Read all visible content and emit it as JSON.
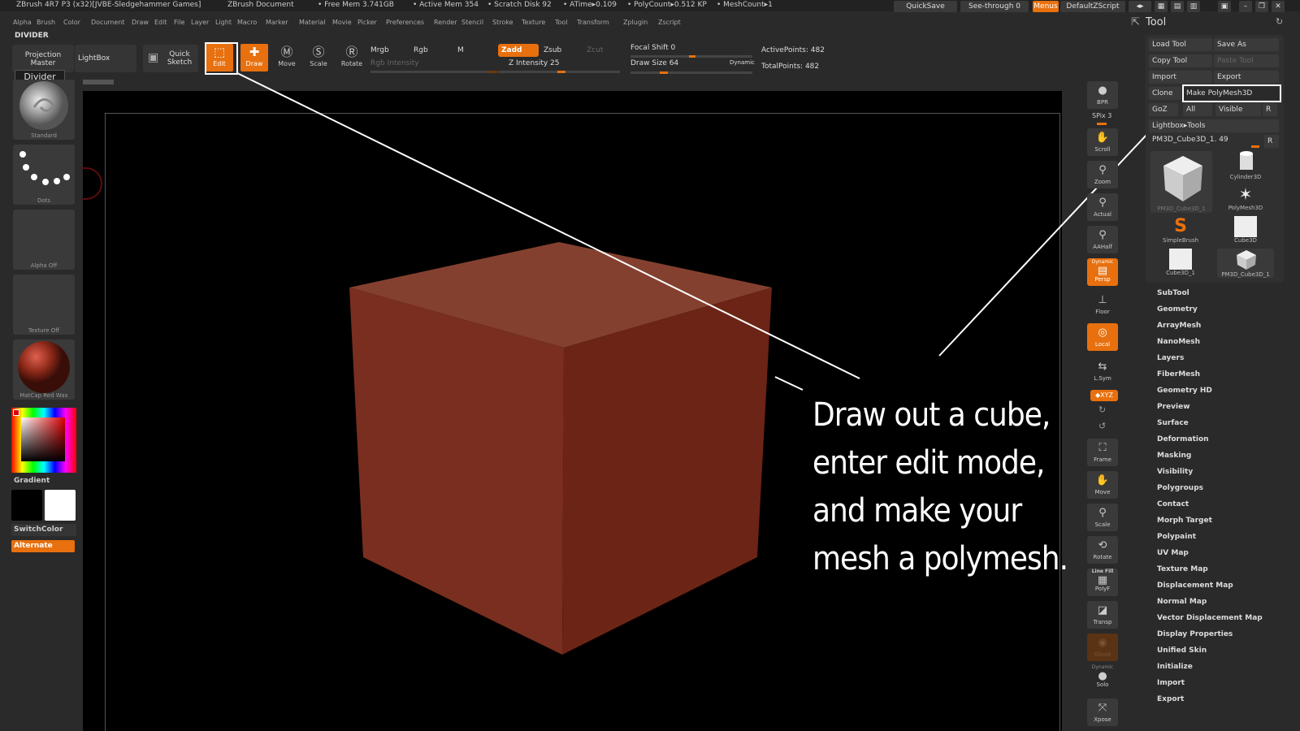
{
  "titlebar": {
    "app": "ZBrush 4R7 P3 (x32)[JVBE-Sledgehammer Games]",
    "doc": "ZBrush Document",
    "free_mem": "• Free Mem 3.741GB",
    "active_mem": "• Active Mem 354",
    "scratch": "• Scratch Disk 92",
    "atime": "• ATime▸0.109",
    "polycount": "• PolyCount▸0.512 KP",
    "meshcount": "• MeshCount▸1",
    "quicksave": "QuickSave",
    "seethrough": "See-through  0",
    "menus": "Menus",
    "script": "DefaultZScript"
  },
  "menubar": [
    "Alpha",
    "Brush",
    "Color",
    "Document",
    "Draw",
    "Edit",
    "File",
    "Layer",
    "Light",
    "Macro",
    "Marker",
    "Material",
    "Movie",
    "Picker",
    "Preferences",
    "Render",
    "Stencil",
    "Stroke",
    "Texture",
    "Tool",
    "Transform",
    "Zplugin",
    "Zscript"
  ],
  "divider_label": "DIVIDER",
  "shelf": {
    "projection_master": "Projection Master",
    "divider_popup": "Divider",
    "lightbox": "LightBox",
    "quick_sketch": "Quick Sketch",
    "edit": "Edit",
    "draw": "Draw",
    "move": "Move",
    "scale": "Scale",
    "rotate": "Rotate",
    "mrgb": "Mrgb",
    "rgb": "Rgb",
    "m": "M",
    "rgb_intensity": "Rgb Intensity",
    "zadd": "Zadd",
    "zsub": "Zsub",
    "zcut": "Zcut",
    "z_intensity": "Z Intensity 25",
    "focal_shift": "Focal Shift 0",
    "draw_size": "Draw Size 64",
    "dynamic": "Dynamic",
    "active_points": "ActivePoints: 482",
    "total_points": "TotalPoints: 482"
  },
  "left": {
    "standard": "Standard",
    "dots": "Dots",
    "alpha_off": "Alpha Off",
    "texture_off": "Texture Off",
    "matcap": "MatCap Red Wax",
    "gradient": "Gradient",
    "switchcolor": "SwitchColor",
    "alternate": "Alternate"
  },
  "right_strip": {
    "bpr": "BPR",
    "spix": "SPix 3",
    "scroll": "Scroll",
    "zoom": "Zoom",
    "actual": "Actual",
    "aahalf": "AAHalf",
    "dynamic": "Dynamic",
    "persp": "Persp",
    "floor": "Floor",
    "local": "Local",
    "lsym": "L.Sym",
    "xyz": "◆XYZ",
    "frame": "Frame",
    "move": "Move",
    "scale": "Scale",
    "rotate": "Rotate",
    "linefill": "Line Fill",
    "polyf": "PolyF",
    "transp": "Transp",
    "ghost": "Ghost",
    "dynamic2": "Dynamic",
    "solo": "Solo",
    "xpose": "Xpose"
  },
  "tool": {
    "header": "Tool",
    "load": "Load Tool",
    "save_as": "Save As",
    "copy": "Copy Tool",
    "paste": "Paste Tool",
    "import": "Import",
    "export": "Export",
    "clone": "Clone",
    "make_polymesh": "Make PolyMesh3D",
    "goz": "GoZ",
    "all": "All",
    "visible": "Visible",
    "r": "R",
    "lightbox_tools": "Lightbox▸Tools",
    "current": "PM3D_Cube3D_1. 49",
    "r2": "R",
    "items": [
      "PM3D_Cube3D_1",
      "Cylinder3D",
      "PolyMesh3D",
      "SimpleBrush",
      "Cube3D",
      "Cube3D_1",
      "PM3D_Cube3D_1"
    ],
    "list": [
      "SubTool",
      "Geometry",
      "ArrayMesh",
      "NanoMesh",
      "Layers",
      "FiberMesh",
      "Geometry HD",
      "Preview",
      "Surface",
      "Deformation",
      "Masking",
      "Visibility",
      "Polygroups",
      "Contact",
      "Morph Target",
      "Polypaint",
      "UV Map",
      "Texture Map",
      "Displacement Map",
      "Normal Map",
      "Vector Displacement Map",
      "Display Properties",
      "Unified Skin",
      "Initialize",
      "Import",
      "Export"
    ]
  },
  "annotation": {
    "line1": "Draw out a cube,",
    "line2": "enter edit mode,",
    "line3": "and make your",
    "line4": "mesh a polymesh."
  },
  "colors": {
    "accent": "#e8700e",
    "cube_front": "#7a2e1f",
    "cube_top": "#84402f",
    "cube_right": "#6b2416"
  }
}
